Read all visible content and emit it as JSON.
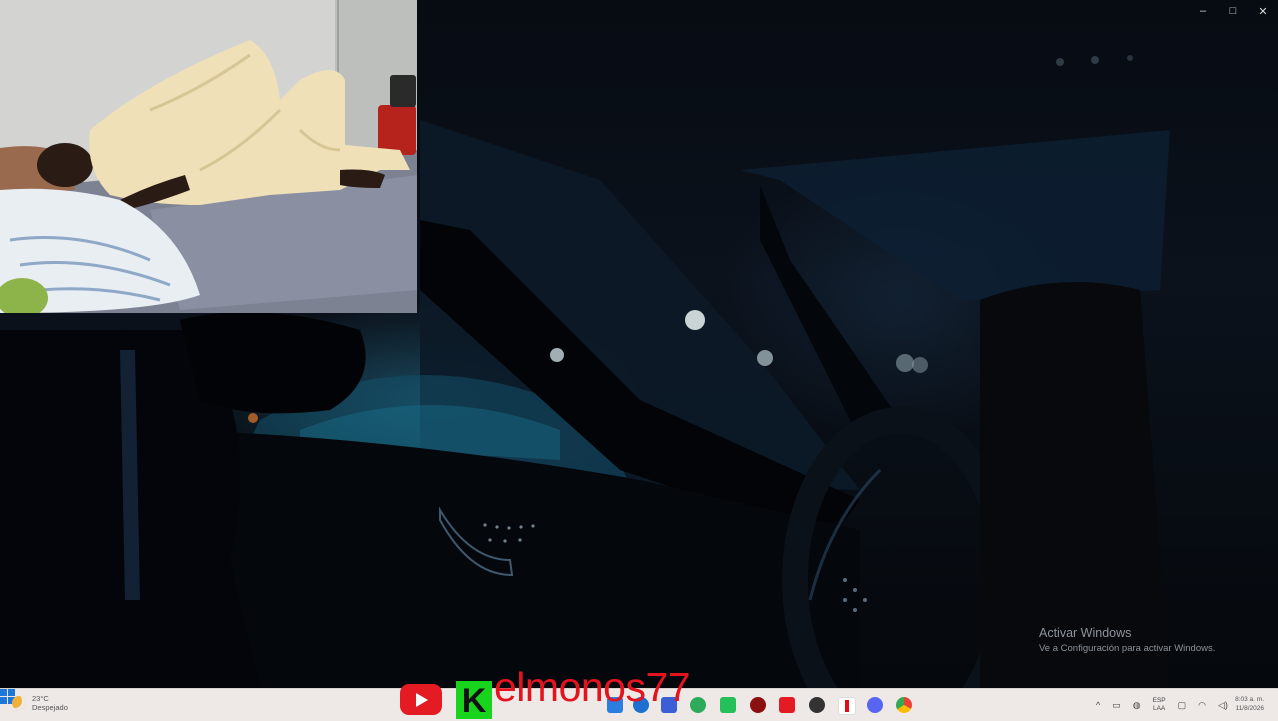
{
  "window_controls": {
    "minimize": "‒",
    "restore": "□",
    "close": "✕"
  },
  "watermark": {
    "title": "Activar Windows",
    "subtitle": "Ve a Configuración para activar Windows."
  },
  "overlay": {
    "channel_name": "elmonos77",
    "k_logo_text": "K"
  },
  "taskbar": {
    "weather": {
      "temp": "23°C",
      "condition": "Despejado"
    },
    "tray": {
      "lang_top": "ESP",
      "lang_bottom": "LAA",
      "chevron": "^"
    },
    "clock": {
      "time": "8:03 a. m.",
      "date": "11/8/2026"
    }
  },
  "colors": {
    "youtube_red": "#e51b23",
    "channel_text": "#e3141e",
    "k_green": "#19d41c",
    "taskbar_bg": "#eee9e6"
  }
}
